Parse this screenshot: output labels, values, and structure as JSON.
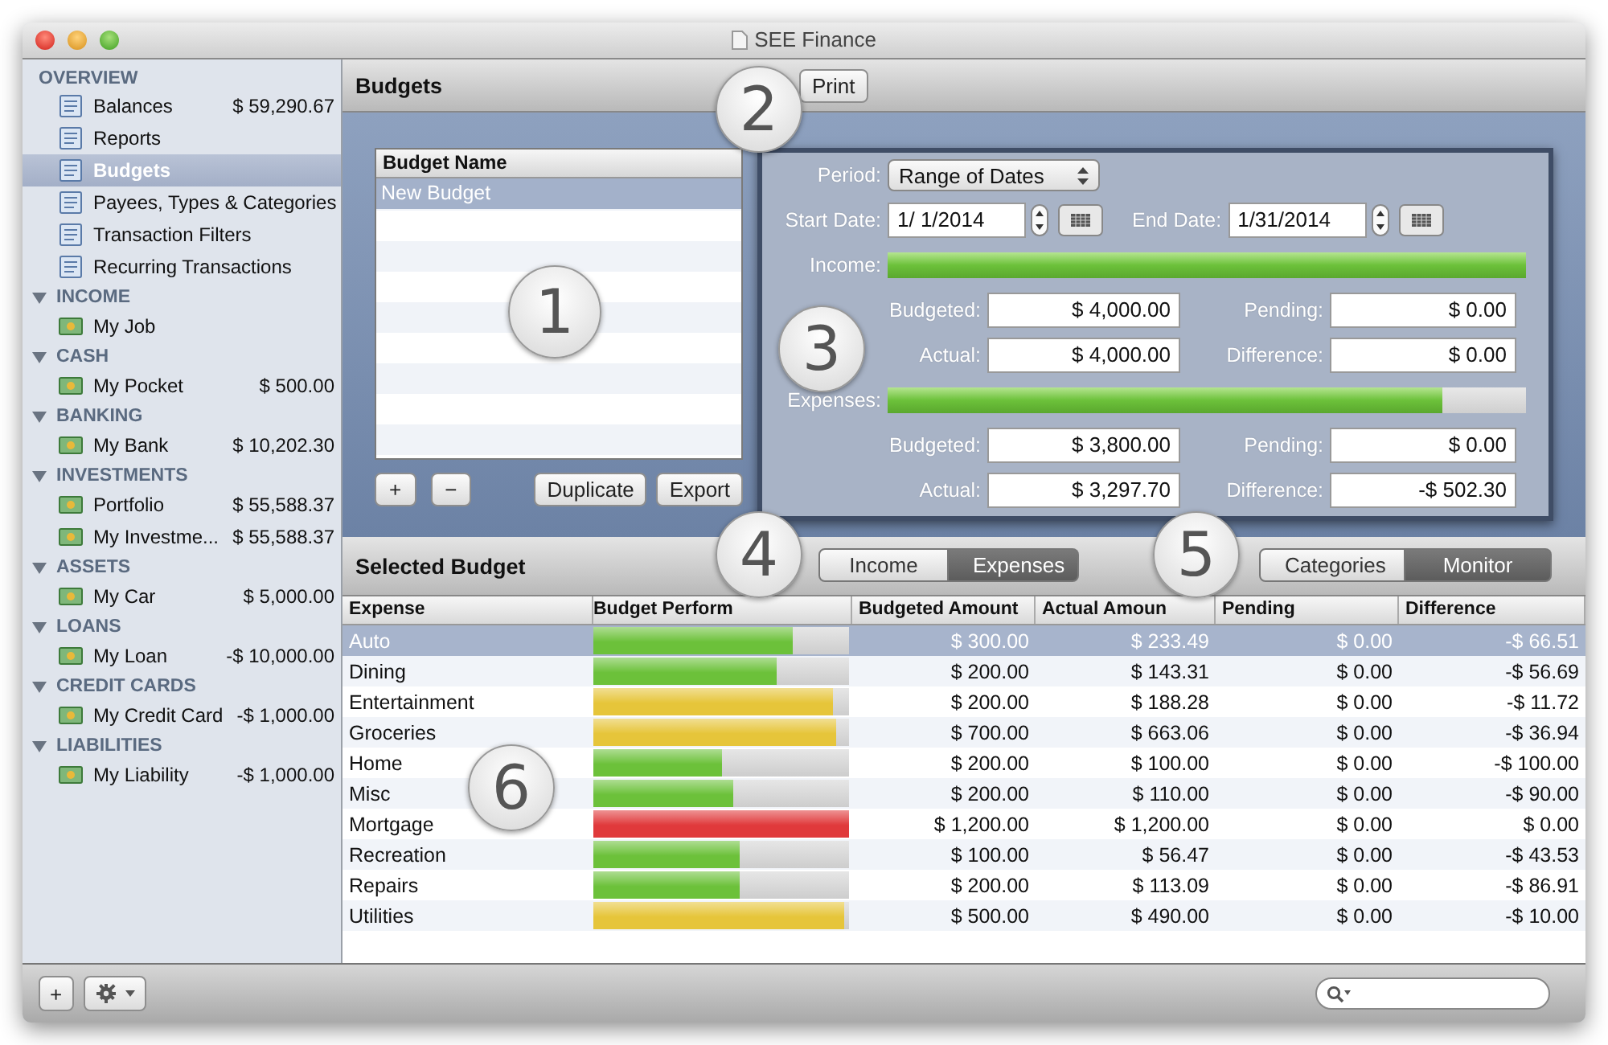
{
  "window": {
    "title": "SEE Finance"
  },
  "sidebar": {
    "overview": {
      "header": "OVERVIEW",
      "items": [
        {
          "label": "Balances",
          "amount": "$ 59,290.67",
          "selected": false
        },
        {
          "label": "Reports",
          "selected": false
        },
        {
          "label": "Budgets",
          "selected": true
        },
        {
          "label": "Payees, Types & Categories",
          "selected": false
        },
        {
          "label": "Transaction Filters",
          "selected": false
        },
        {
          "label": "Recurring Transactions",
          "selected": false
        }
      ]
    },
    "groups": [
      {
        "header": "INCOME",
        "expanded": true,
        "items": [
          {
            "label": "My Job",
            "selected": false
          }
        ]
      },
      {
        "header": "CASH",
        "expanded": true,
        "items": [
          {
            "label": "My Pocket",
            "amount": "$ 500.00",
            "selected": false
          }
        ]
      },
      {
        "header": "BANKING",
        "expanded": true,
        "items": [
          {
            "label": "My Bank",
            "amount": "$ 10,202.30",
            "selected": false
          }
        ]
      },
      {
        "header": "INVESTMENTS",
        "expanded": true,
        "items": [
          {
            "label": "Portfolio",
            "amount": "$ 55,588.37",
            "selected": false
          },
          {
            "label": "My Investme...",
            "amount": "$ 55,588.37",
            "selected": false
          }
        ]
      },
      {
        "header": "ASSETS",
        "expanded": true,
        "items": [
          {
            "label": "My Car",
            "amount": "$ 5,000.00",
            "selected": false
          }
        ]
      },
      {
        "header": "LOANS",
        "expanded": true,
        "items": [
          {
            "label": "My Loan",
            "amount": "-$ 10,000.00",
            "selected": false
          }
        ]
      },
      {
        "header": "CREDIT CARDS",
        "expanded": true,
        "items": [
          {
            "label": "My Credit Card",
            "amount": "-$ 1,000.00",
            "selected": false
          }
        ]
      },
      {
        "header": "LIABILITIES",
        "expanded": true,
        "items": [
          {
            "label": "My Liability",
            "amount": "-$ 1,000.00",
            "selected": false
          }
        ]
      }
    ]
  },
  "budgets_bar": {
    "title": "Budgets",
    "print": "Print"
  },
  "budget_list": {
    "column": "Budget Name",
    "rows": [
      {
        "label": "New Budget",
        "selected": true
      }
    ],
    "buttons": [
      "+",
      "−",
      "Duplicate",
      "Export"
    ]
  },
  "details": {
    "period_label": "Period:",
    "period": "Range of Dates",
    "start_label": "Start Date:",
    "start": "1/  1/2014",
    "end_label": "End Date:",
    "end": "1/31/2014",
    "sections": [
      {
        "label": "Income:",
        "level": 1.0,
        "budgeted_label": "Budgeted:",
        "budgeted": "$ 4,000.00",
        "pending_label": "Pending:",
        "pending": "$ 0.00",
        "actual_label": "Actual:",
        "actual": "$ 4,000.00",
        "difference_label": "Difference:",
        "difference": "$ 0.00"
      },
      {
        "label": "Expenses:",
        "level": 0.87,
        "budgeted_label": "Budgeted:",
        "budgeted": "$ 3,800.00",
        "pending_label": "Pending:",
        "pending": "$ 0.00",
        "actual_label": "Actual:",
        "actual": "$ 3,297.70",
        "difference_label": "Difference:",
        "difference": "-$ 502.30"
      }
    ]
  },
  "selected_bar": {
    "title": "Selected Budget",
    "type_tabs": [
      {
        "label": "Income",
        "selected": false
      },
      {
        "label": "Expenses",
        "selected": true
      }
    ],
    "view_tabs": [
      {
        "label": "Categories",
        "selected": false
      },
      {
        "label": "Monitor",
        "selected": true
      }
    ]
  },
  "table": {
    "columns": [
      "Expense",
      "Budget Perform",
      "Budgeted Amount",
      "Actual Amoun",
      "Pending",
      "Difference"
    ],
    "rows": [
      {
        "expense": "Auto",
        "level": 0.78,
        "color": "#6cc13a",
        "budgeted": "$ 300.00",
        "actual": "$ 233.49",
        "pending": "$ 0.00",
        "difference": "-$ 66.51",
        "selected": true
      },
      {
        "expense": "Dining",
        "level": 0.72,
        "color": "#6cc13a",
        "budgeted": "$ 200.00",
        "actual": "$ 143.31",
        "pending": "$ 0.00",
        "difference": "-$ 56.69",
        "selected": false
      },
      {
        "expense": "Entertainment",
        "level": 0.94,
        "color": "#e6c53a",
        "budgeted": "$ 200.00",
        "actual": "$ 188.28",
        "pending": "$ 0.00",
        "difference": "-$ 11.72",
        "selected": false
      },
      {
        "expense": "Groceries",
        "level": 0.95,
        "color": "#e6c53a",
        "budgeted": "$ 700.00",
        "actual": "$ 663.06",
        "pending": "$ 0.00",
        "difference": "-$ 36.94",
        "selected": false
      },
      {
        "expense": "Home",
        "level": 0.5,
        "color": "#6cc13a",
        "budgeted": "$ 200.00",
        "actual": "$ 100.00",
        "pending": "$ 0.00",
        "difference": "-$ 100.00",
        "selected": false
      },
      {
        "expense": "Misc",
        "level": 0.55,
        "color": "#6cc13a",
        "budgeted": "$ 200.00",
        "actual": "$ 110.00",
        "pending": "$ 0.00",
        "difference": "-$ 90.00",
        "selected": false
      },
      {
        "expense": "Mortgage",
        "level": 1.0,
        "color": "#e0393b",
        "budgeted": "$ 1,200.00",
        "actual": "$ 1,200.00",
        "pending": "$ 0.00",
        "difference": "$ 0.00",
        "selected": false
      },
      {
        "expense": "Recreation",
        "level": 0.57,
        "color": "#6cc13a",
        "budgeted": "$ 100.00",
        "actual": "$ 56.47",
        "pending": "$ 0.00",
        "difference": "-$ 43.53",
        "selected": false
      },
      {
        "expense": "Repairs",
        "level": 0.57,
        "color": "#6cc13a",
        "budgeted": "$ 200.00",
        "actual": "$ 113.09",
        "pending": "$ 0.00",
        "difference": "-$ 86.91",
        "selected": false
      },
      {
        "expense": "Utilities",
        "level": 0.98,
        "color": "#e6c53a",
        "budgeted": "$ 500.00",
        "actual": "$ 490.00",
        "pending": "$ 0.00",
        "difference": "-$ 10.00",
        "selected": false
      }
    ]
  },
  "bottom_bar": {
    "add": "+"
  },
  "callouts": [
    "1",
    "2",
    "3",
    "4",
    "5",
    "6"
  ]
}
